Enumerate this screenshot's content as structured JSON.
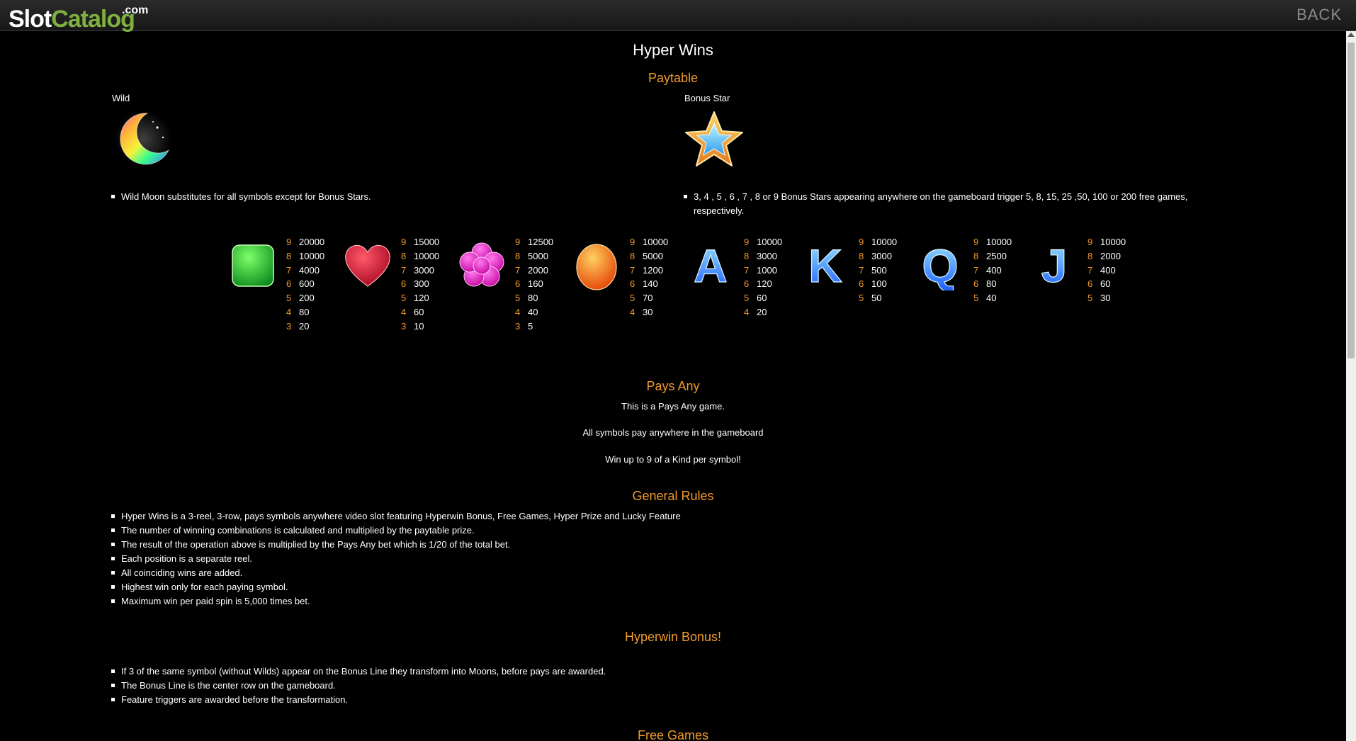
{
  "header": {
    "logo_slot": "Slot",
    "logo_catalog": "Catalog",
    "logo_com": ".com",
    "back_label": "BACK"
  },
  "page": {
    "title": "Hyper Wins",
    "paytable_heading": "Paytable",
    "wild": {
      "label": "Wild",
      "icon": "moon-icon",
      "rule": "Wild Moon substitutes for all symbols except for Bonus Stars."
    },
    "bonus_star": {
      "label": "Bonus Star",
      "icon": "star-icon",
      "rule_line1": "3, 4 , 5 , 6 , 7 , 8 or 9 Bonus Stars appearing anywhere on the gameboard trigger 5, 8, 15, 25 ,50, 100 or 200 free games,",
      "rule_line2": "respectively."
    },
    "symbols": [
      {
        "icon": "green-gem-icon",
        "pays": [
          [
            "9",
            "20000"
          ],
          [
            "8",
            "10000"
          ],
          [
            "7",
            "4000"
          ],
          [
            "6",
            "600"
          ],
          [
            "5",
            "200"
          ],
          [
            "4",
            "80"
          ],
          [
            "3",
            "20"
          ]
        ]
      },
      {
        "icon": "red-heart-icon",
        "pays": [
          [
            "9",
            "15000"
          ],
          [
            "8",
            "10000"
          ],
          [
            "7",
            "3000"
          ],
          [
            "6",
            "300"
          ],
          [
            "5",
            "120"
          ],
          [
            "4",
            "60"
          ],
          [
            "3",
            "10"
          ]
        ]
      },
      {
        "icon": "pink-flower-icon",
        "pays": [
          [
            "9",
            "12500"
          ],
          [
            "8",
            "5000"
          ],
          [
            "7",
            "2000"
          ],
          [
            "6",
            "160"
          ],
          [
            "5",
            "80"
          ],
          [
            "4",
            "40"
          ],
          [
            "3",
            "5"
          ]
        ]
      },
      {
        "icon": "orange-gem-icon",
        "pays": [
          [
            "9",
            "10000"
          ],
          [
            "8",
            "5000"
          ],
          [
            "7",
            "1200"
          ],
          [
            "6",
            "140"
          ],
          [
            "5",
            "70"
          ],
          [
            "4",
            "30"
          ]
        ]
      },
      {
        "icon": "letter-a-icon",
        "letter": "A",
        "pays": [
          [
            "9",
            "10000"
          ],
          [
            "8",
            "3000"
          ],
          [
            "7",
            "1000"
          ],
          [
            "6",
            "120"
          ],
          [
            "5",
            "60"
          ],
          [
            "4",
            "20"
          ]
        ]
      },
      {
        "icon": "letter-k-icon",
        "letter": "K",
        "pays": [
          [
            "9",
            "10000"
          ],
          [
            "8",
            "3000"
          ],
          [
            "7",
            "500"
          ],
          [
            "6",
            "100"
          ],
          [
            "5",
            "50"
          ]
        ]
      },
      {
        "icon": "letter-q-icon",
        "letter": "Q",
        "pays": [
          [
            "9",
            "10000"
          ],
          [
            "8",
            "2500"
          ],
          [
            "7",
            "400"
          ],
          [
            "6",
            "80"
          ],
          [
            "5",
            "40"
          ]
        ]
      },
      {
        "icon": "letter-j-icon",
        "letter": "J",
        "pays": [
          [
            "9",
            "10000"
          ],
          [
            "8",
            "2000"
          ],
          [
            "7",
            "400"
          ],
          [
            "6",
            "60"
          ],
          [
            "5",
            "30"
          ]
        ]
      }
    ],
    "pays_any": {
      "heading": "Pays Any",
      "line1": "This is a Pays Any game.",
      "line2": "All symbols pay anywhere in the gameboard",
      "line3": "Win up to 9 of a Kind per symbol!"
    },
    "general_rules": {
      "heading": "General Rules",
      "items": [
        "Hyper Wins is a 3-reel, 3-row, pays symbols anywhere video slot featuring Hyperwin Bonus, Free Games, Hyper Prize and Lucky Feature",
        "The number of winning combinations is calculated and multiplied by the paytable prize.",
        "The result of the operation above is multiplied by the Pays Any bet which is 1/20 of the total bet.",
        "Each position is a separate reel.",
        "All coinciding wins are added.",
        "Highest win only for each paying symbol.",
        "Maximum win per paid spin is 5,000 times bet."
      ]
    },
    "hyperwin_bonus": {
      "heading": "Hyperwin Bonus!",
      "items": [
        "If 3 of the same symbol (without Wilds) appear on the Bonus Line they transform into Moons, before pays are awarded.",
        "The Bonus Line is the center row on the gameboard.",
        "Feature triggers are awarded before the transformation."
      ]
    },
    "free_games_heading": "Free Games"
  }
}
